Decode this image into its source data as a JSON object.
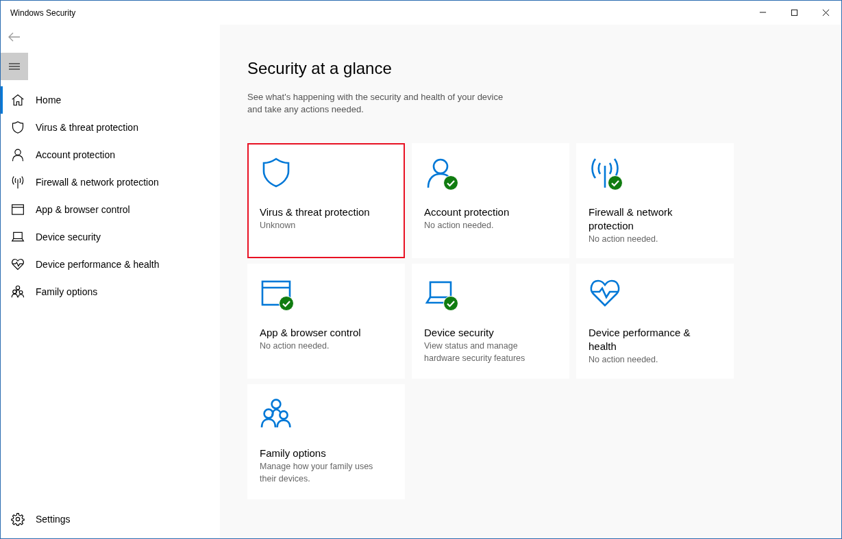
{
  "window": {
    "title": "Windows Security"
  },
  "sidebar": {
    "items": [
      {
        "label": "Home",
        "kind": "home",
        "selected": true
      },
      {
        "label": "Virus & threat protection",
        "kind": "shield",
        "selected": false
      },
      {
        "label": "Account protection",
        "kind": "person",
        "selected": false
      },
      {
        "label": "Firewall & network protection",
        "kind": "antenna",
        "selected": false
      },
      {
        "label": "App & browser control",
        "kind": "window",
        "selected": false
      },
      {
        "label": "Device security",
        "kind": "laptop",
        "selected": false
      },
      {
        "label": "Device performance & health",
        "kind": "heart",
        "selected": false
      },
      {
        "label": "Family options",
        "kind": "family",
        "selected": false
      }
    ],
    "settings": {
      "label": "Settings"
    }
  },
  "main": {
    "title": "Security at a glance",
    "description": "See what's happening with the security and health of your device and take any actions needed.",
    "tiles": [
      {
        "kind": "shield",
        "title": "Virus & threat protection",
        "status": "Unknown",
        "status_ok": false,
        "highlighted": true
      },
      {
        "kind": "person",
        "title": "Account protection",
        "status": "No action needed.",
        "status_ok": true,
        "highlighted": false
      },
      {
        "kind": "antenna",
        "title": "Firewall & network protection",
        "status": "No action needed.",
        "status_ok": true,
        "highlighted": false
      },
      {
        "kind": "window",
        "title": "App & browser control",
        "status": "No action needed.",
        "status_ok": true,
        "highlighted": false
      },
      {
        "kind": "laptop",
        "title": "Device security",
        "status": "View status and manage hardware security features",
        "status_ok": true,
        "highlighted": false
      },
      {
        "kind": "heart",
        "title": "Device performance & health",
        "status": "No action needed.",
        "status_ok": false,
        "highlighted": false
      },
      {
        "kind": "family",
        "title": "Family options",
        "status": "Manage how your family uses their devices.",
        "status_ok": false,
        "highlighted": false
      }
    ]
  }
}
